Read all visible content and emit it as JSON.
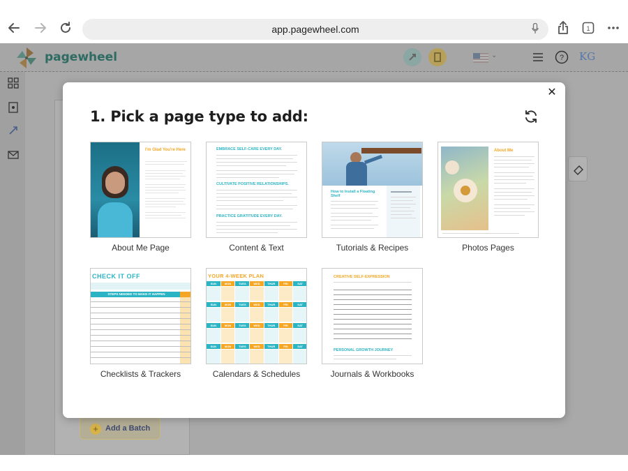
{
  "browser": {
    "url": "app.pagewheel.com"
  },
  "app": {
    "logo_text": "pagewheel",
    "add_batch_label": "Add a Batch"
  },
  "modal": {
    "title": "1. Pick a page type to add:",
    "tiles": [
      {
        "label": "About Me Page",
        "heading": "I'm Glad You're Here"
      },
      {
        "label": "Content & Text",
        "headings": [
          "EMBRACE SELF-CARE EVERY DAY.",
          "CULTIVATE POSITIVE RELATIONSHIPS.",
          "PRACTICE GRATITUDE EVERY DAY."
        ]
      },
      {
        "label": "Tutorials & Recipes",
        "heading": "How to Install a Floating Shelf"
      },
      {
        "label": "Photos Pages",
        "heading": "About Me"
      },
      {
        "label": "Checklists & Trackers",
        "heading": "CHECK IT OFF",
        "subheading": "STEPS NEEDED TO MAKE IT HAPPEN"
      },
      {
        "label": "Calendars & Schedules",
        "heading": "YOUR 4-WEEK PLAN",
        "days": [
          "SUN",
          "MON",
          "TUES",
          "WED",
          "THUR",
          "FRI",
          "SAT"
        ]
      },
      {
        "label": "Journals & Workbooks",
        "headings": [
          "CREATIVE SELF-EXPRESSION",
          "PERSONAL GROWTH JOURNEY"
        ]
      }
    ]
  },
  "colors": {
    "teal": "#2bb5c4",
    "orange": "#f5a623",
    "brand_green": "#2e6b63"
  },
  "icons": [
    "back-arrow-icon",
    "forward-arrow-icon",
    "reload-icon",
    "mic-icon",
    "share-icon",
    "tabs-icon",
    "more-icon",
    "close-icon",
    "refresh-icon"
  ]
}
